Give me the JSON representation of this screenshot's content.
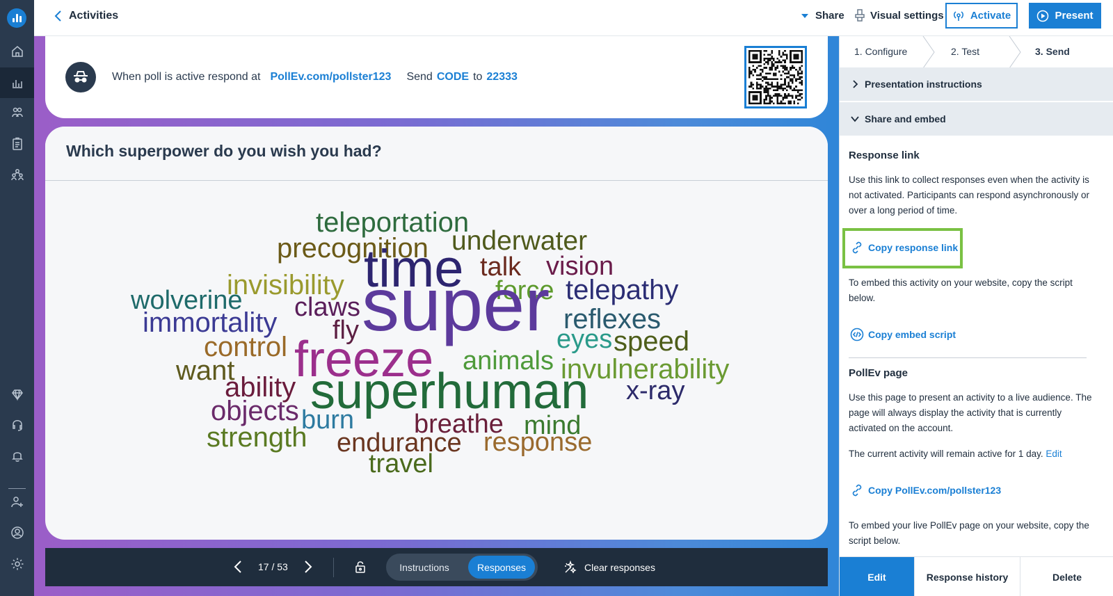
{
  "nav": {
    "back_label": "Activities"
  },
  "toolbar": {
    "share_label": "Share",
    "visual_settings_label": "Visual settings",
    "activate_label": "Activate",
    "present_label": "Present"
  },
  "respond": {
    "prefix": "When poll is active respond at",
    "url": "PollEv.com/pollster123",
    "send_word": "Send",
    "code": "CODE",
    "to_word": "to",
    "number": "22333"
  },
  "question": {
    "title": "Which superpower do you wish you had?"
  },
  "word_cloud": [
    {
      "text": "teleportation",
      "color": "#2e6b3e"
    },
    {
      "text": "underwater",
      "color": "#4f5a1c"
    },
    {
      "text": "precognition",
      "color": "#6b5a18"
    },
    {
      "text": "time",
      "color": "#2d2570"
    },
    {
      "text": "talk",
      "color": "#6b2a1e"
    },
    {
      "text": "vision",
      "color": "#6a1c4a"
    },
    {
      "text": "invisibility",
      "color": "#9a9a2e"
    },
    {
      "text": "force",
      "color": "#5d9a2c"
    },
    {
      "text": "telepathy",
      "color": "#2b2d74"
    },
    {
      "text": "wolverine",
      "color": "#1e6a6a"
    },
    {
      "text": "claws",
      "color": "#5a1e5a"
    },
    {
      "text": "super",
      "color": "#5c3a9c"
    },
    {
      "text": "immortality",
      "color": "#3b3a94"
    },
    {
      "text": "reflexes",
      "color": "#2a5a6e"
    },
    {
      "text": "fly",
      "color": "#5c1f42"
    },
    {
      "text": "eyes",
      "color": "#2a9a8a"
    },
    {
      "text": "speed",
      "color": "#4e5e1a"
    },
    {
      "text": "control",
      "color": "#9a6a28"
    },
    {
      "text": "freeze",
      "color": "#9b2f8c"
    },
    {
      "text": "animals",
      "color": "#4e9a3a"
    },
    {
      "text": "invulnerability",
      "color": "#6a9a32"
    },
    {
      "text": "want",
      "color": "#5e5a1e"
    },
    {
      "text": "ability",
      "color": "#6a1c3c"
    },
    {
      "text": "superhuman",
      "color": "#226b3a"
    },
    {
      "text": "x-ray",
      "color": "#2c2a6a"
    },
    {
      "text": "objects",
      "color": "#6a2a6a"
    },
    {
      "text": "burn",
      "color": "#2d7aa0"
    },
    {
      "text": "breathe",
      "color": "#6a1f3a"
    },
    {
      "text": "strength",
      "color": "#5a7a22"
    },
    {
      "text": "mind",
      "color": "#3a7a2e"
    },
    {
      "text": "endurance",
      "color": "#6a3620"
    },
    {
      "text": "response",
      "color": "#9a6a2e"
    },
    {
      "text": "travel",
      "color": "#4a6a1c"
    }
  ],
  "pager": {
    "count": "17 / 53",
    "instructions_label": "Instructions",
    "responses_label": "Responses",
    "clear_label": "Clear responses"
  },
  "panel": {
    "steps": [
      "1. Configure",
      "2. Test",
      "3. Send"
    ],
    "acc_presentation": "Presentation instructions",
    "acc_share": "Share and embed",
    "response_link_heading": "Response link",
    "response_link_text": "Use this link to collect responses even when the activity is not activated. Participants can respond asynchronously or over a long period of time.",
    "copy_response_link": "Copy response link",
    "embed_text": "To embed this activity on your website, copy the script below.",
    "copy_embed_script": "Copy embed script",
    "pollev_heading": "PollEv page",
    "pollev_text": "Use this page to present an activity to a live audience. The page will always display the activity that is currently activated on the account.",
    "active_text": "The current activity will remain active for 1 day.",
    "active_edit": "Edit",
    "copy_pollev": "Copy PollEv.com/pollster123",
    "embed_live_text": "To embed your live PollEv page on your website, copy the script below."
  },
  "bottom_tabs": {
    "edit": "Edit",
    "history": "Response history",
    "delete": "Delete"
  },
  "colors": {
    "accent": "#1a7fd4",
    "rail": "#2a3a4e",
    "highlight": "#7ac143"
  }
}
